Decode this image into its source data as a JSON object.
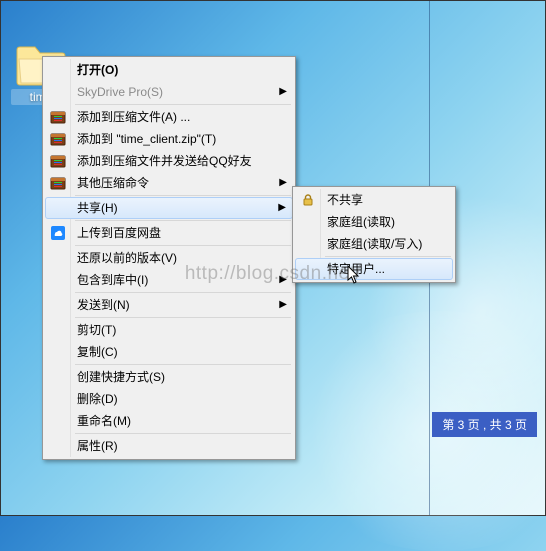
{
  "desktop": {
    "folder_label": "time"
  },
  "menu": {
    "open": "打开(O)",
    "skydrive": "SkyDrive Pro(S)",
    "add_compress": "添加到压缩文件(A) ...",
    "add_to_zip": "添加到 \"time_client.zip\"(T)",
    "add_compress_qq": "添加到压缩文件并发送给QQ好友",
    "other_compress": "其他压缩命令",
    "share": "共享(H)",
    "baidu_upload": "上传到百度网盘",
    "restore_version": "还原以前的版本(V)",
    "include_library": "包含到库中(I)",
    "send_to": "发送到(N)",
    "cut": "剪切(T)",
    "copy": "复制(C)",
    "shortcut": "创建快捷方式(S)",
    "delete": "删除(D)",
    "rename": "重命名(M)",
    "properties": "属性(R)"
  },
  "submenu": {
    "no_share": "不共享",
    "homegroup_read": "家庭组(读取)",
    "homegroup_rw": "家庭组(读取/写入)",
    "specific_users": "特定用户..."
  },
  "watermark": "http://blog.csdn.net/",
  "page_badge": "第 3 页 , 共 3 页"
}
